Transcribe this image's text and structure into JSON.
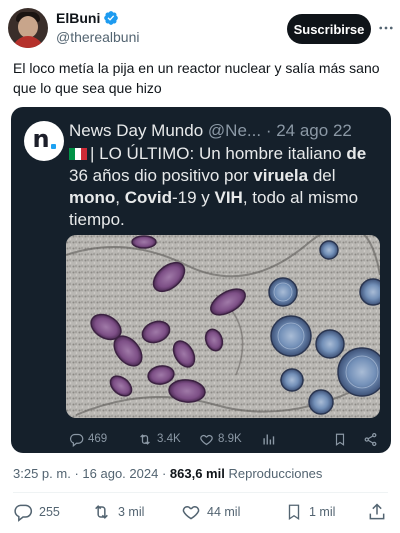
{
  "author": {
    "name": "ElBuni",
    "handle": "@therealbuni",
    "verified": true
  },
  "header": {
    "follow_label": "Suscribirse",
    "more_icon": "more-horizontal-icon"
  },
  "tweet": {
    "text": "El loco metía la pija en un reactor nuclear y salía más sano que lo que sea que hizo"
  },
  "quoted": {
    "account_name": "News Day Mundo",
    "handle_truncated": "@Ne...",
    "separator": "·",
    "date": "24 ago 22",
    "text_parts": {
      "p1": "| LO ÚLTIMO: Un hombre italiano ",
      "b1": "de",
      "p2": " 36 años dio positivo por ",
      "b2": "viruela",
      "p3": " del ",
      "b3": "mono",
      "p4": ", ",
      "b4": "Covid",
      "p5": "-19 y ",
      "b5": "VIH",
      "p6": ", todo al mismo tiempo."
    },
    "flag": "italy",
    "logo_letter": "n",
    "actions": {
      "replies": "469",
      "retweets": "3.4K",
      "likes": "8.9K"
    }
  },
  "meta": {
    "time": "3:25 p. m.",
    "separator": "·",
    "date": "16 ago. 2024",
    "separator2": "·",
    "views": "863,6 mil",
    "views_label": "Reproducciones"
  },
  "actions": {
    "replies": "255",
    "retweets": "3 mil",
    "likes": "44 mil",
    "bookmarks": "1 mil"
  },
  "colors": {
    "accent": "#1d9bf0",
    "quoted_bg": "#15202b",
    "virus_purple": "#7d4f86",
    "virus_blue": "#7390b8"
  }
}
